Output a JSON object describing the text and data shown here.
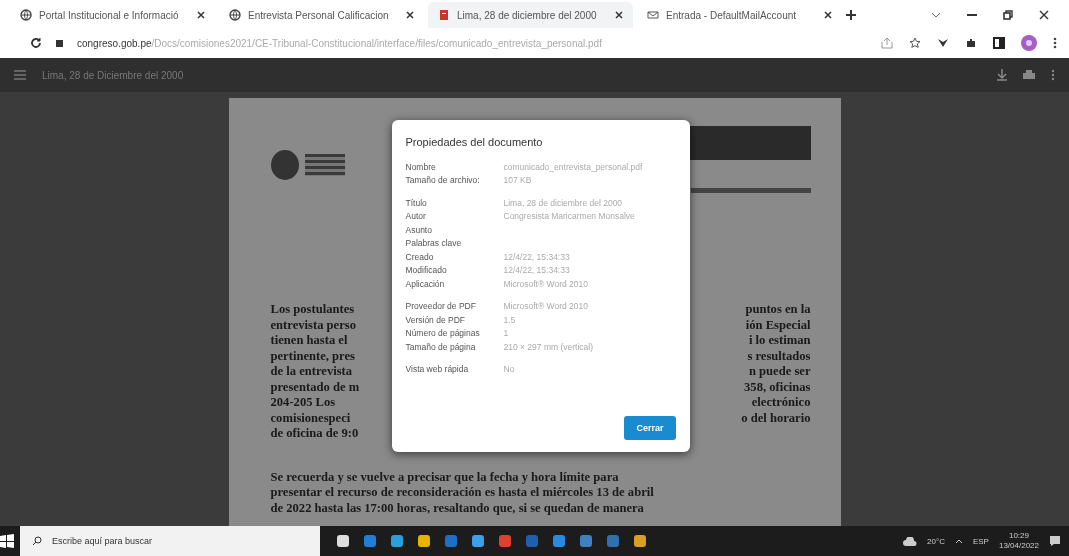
{
  "tabs": [
    {
      "title": "Portal Institucional e Informació",
      "selected": false
    },
    {
      "title": "Entrevista Personal Calificacion",
      "selected": false
    },
    {
      "title": "Lima, 28 de diciembre del 2000",
      "selected": true
    },
    {
      "title": "Entrada - DefaultMailAccount",
      "selected": false
    }
  ],
  "address": {
    "domain": "congreso.gob.pe",
    "path": "/Docs/comisiones2021/CE-Tribunal-Constitucional/interface/files/comunicado_entrevista_personal.pdf"
  },
  "viewer": {
    "title": "Lima, 28 de Diciembre del 2000"
  },
  "document": {
    "left_lines": [
      "Los postulantes",
      "entrevista perso",
      "tienen hasta el",
      "pertinente, pres",
      "de la entrevista",
      "presentado de m",
      "204-205    Los",
      "comisionespeci",
      "de oficina de 9:0"
    ],
    "right_lines": [
      "puntos en la",
      "ión Especial",
      "i lo estiman",
      "s resultados",
      "n puede ser",
      "358, oficinas",
      "electrónico",
      "o del horario"
    ],
    "paragraph_lines": [
      "Se recuerda y se vuelve a precisar que la fecha y hora límite para",
      "presentar el recurso de reconsideración es hasta el miércoles 13 de abril",
      "de 2022 hasta las 17:00 horas, resaltando que, si se quedan de manera"
    ]
  },
  "dialog": {
    "title": "Propiedades del documento",
    "sections": [
      [
        {
          "label": "Nombre",
          "value": "comunicado_entrevista_personal.pdf"
        },
        {
          "label": "Tamaño de archivo:",
          "value": "107 KB"
        }
      ],
      [
        {
          "label": "Título",
          "value": "Lima, 28 de diciembre del 2000"
        },
        {
          "label": "Autor",
          "value": "Congresista Maricarmen Monsalve"
        },
        {
          "label": "Asunto"
        },
        {
          "label": "Palabras clave"
        },
        {
          "label": "Creado",
          "value": "12/4/22, 15:34:33"
        },
        {
          "label": "Modificado",
          "value": "12/4/22, 15:34:33"
        },
        {
          "label": "Aplicación",
          "value": "Microsoft® Word 2010"
        }
      ],
      [
        {
          "label": "Proveedor de PDF",
          "value": "Microsoft® Word 2010"
        },
        {
          "label": "Versión de PDF",
          "value": "1.5"
        },
        {
          "label": "Número de páginas",
          "value": "1"
        },
        {
          "label": "Tamaño de página",
          "value": "210 × 297 mm (vertical)"
        }
      ],
      [
        {
          "label": "Vista web rápida",
          "value": "No"
        }
      ]
    ],
    "button": "Cerrar"
  },
  "taskbar": {
    "search_placeholder": "Escribe aquí para buscar",
    "weather": "20°C",
    "language": "ESP",
    "time": "10:29",
    "date": "13/04/2022"
  }
}
